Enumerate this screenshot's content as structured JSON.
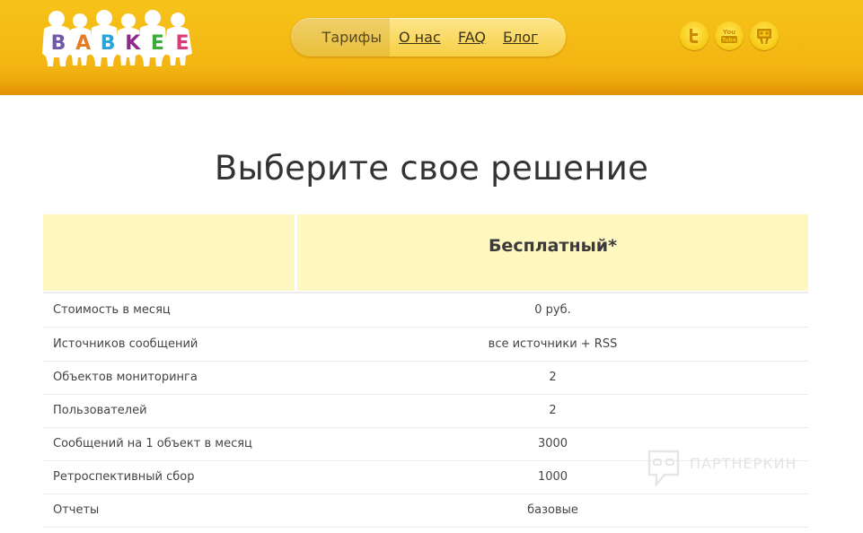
{
  "header": {
    "logo_letters": [
      "B",
      "A",
      "B",
      "K",
      "E",
      "E"
    ],
    "logo_colors": [
      "#6e5aa8",
      "#e37c24",
      "#2aa3d8",
      "#8e2a8a",
      "#3cab3a",
      "#d93c7a"
    ],
    "nav": {
      "tariffs": "Тарифы",
      "about": "О нас",
      "faq": "FAQ",
      "blog": "Блог"
    },
    "social_icons": [
      "twitter-icon",
      "youtube-icon",
      "slideshare-icon"
    ],
    "youtube_text": "You Tube"
  },
  "page_title": "Выберите свое решение",
  "plan": {
    "name": "Бесплатный*"
  },
  "rows": [
    {
      "label": "Стоимость в месяц",
      "value": "0 руб."
    },
    {
      "label": "Источников сообщений",
      "value": "все источники + RSS"
    },
    {
      "label": "Объектов мониторинга",
      "value": "2"
    },
    {
      "label": "Пользователей",
      "value": "2"
    },
    {
      "label": "Сообщений на 1 объект в месяц",
      "value": "3000"
    },
    {
      "label": "Ретроспективный сбор",
      "value": "1000"
    },
    {
      "label": "Отчеты",
      "value": "базовые"
    }
  ],
  "watermark": "ПАРТНЕРКИН",
  "colors": {
    "header": "#f3b512",
    "table_head": "#fff7c0"
  }
}
